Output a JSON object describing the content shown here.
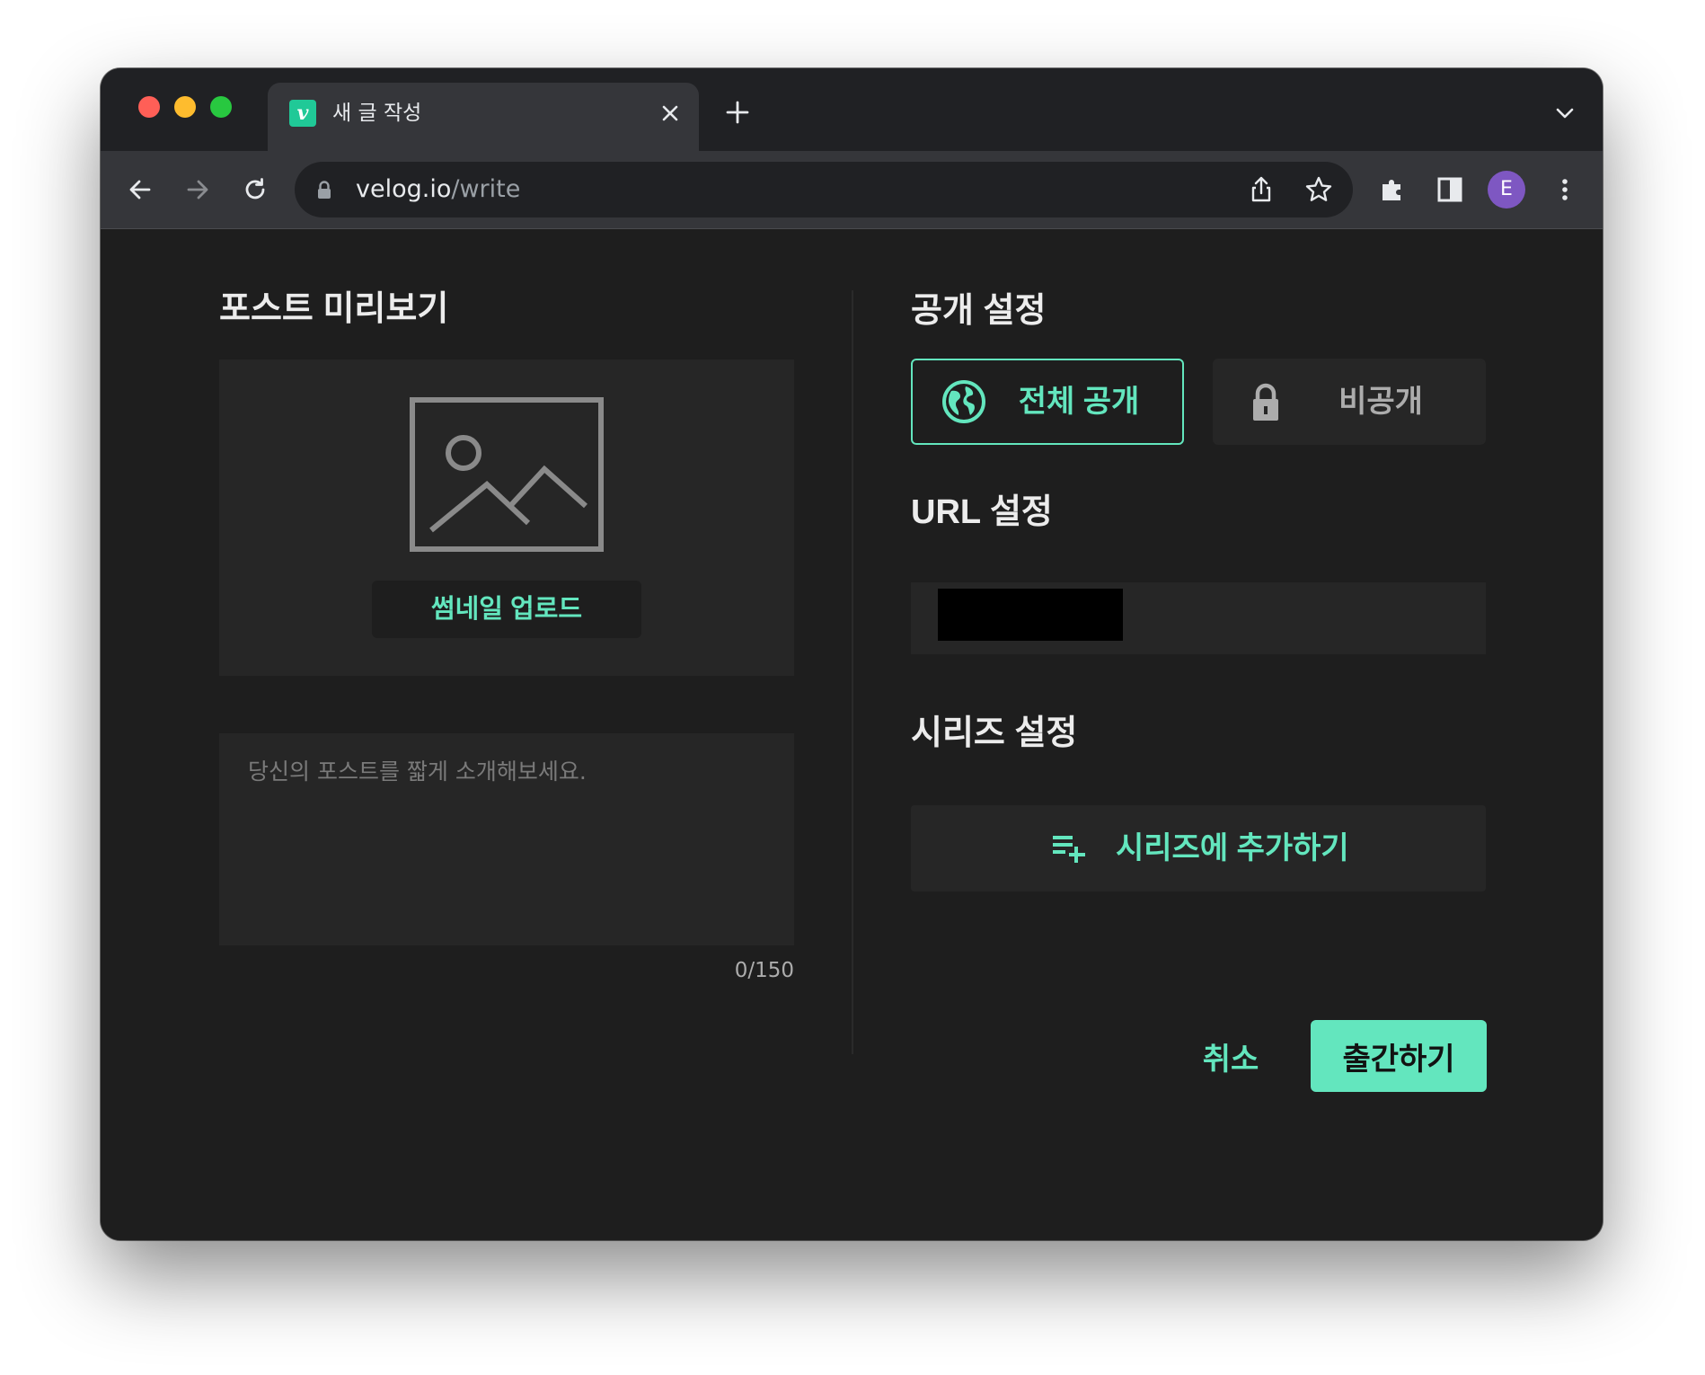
{
  "browser": {
    "tab": {
      "favicon_letter": "v",
      "title": "새 글 작성"
    },
    "omnibox": {
      "host": "velog.io",
      "path": "/write"
    },
    "profile_initial": "E"
  },
  "preview": {
    "title": "포스트 미리보기",
    "thumbnail_upload_label": "썸네일 업로드",
    "description_placeholder": "당신의 포스트를 짧게 소개해보세요.",
    "description_value": "",
    "char_counter": "0/150"
  },
  "settings": {
    "visibility_title": "공개 설정",
    "visibility_options": [
      {
        "label": "전체 공개",
        "icon": "globe-icon",
        "selected": true
      },
      {
        "label": "비공개",
        "icon": "lock-icon",
        "selected": false
      }
    ],
    "url_title": "URL 설정",
    "url_value": "",
    "series_title": "시리즈 설정",
    "series_add_label": "시리즈에 추가하기"
  },
  "actions": {
    "cancel": "취소",
    "publish": "출간하기"
  },
  "colors": {
    "accent": "#63e6be",
    "background": "#1e1e1e",
    "panel": "#262626",
    "favicon": "#20c997",
    "avatar": "#7e57c2"
  }
}
